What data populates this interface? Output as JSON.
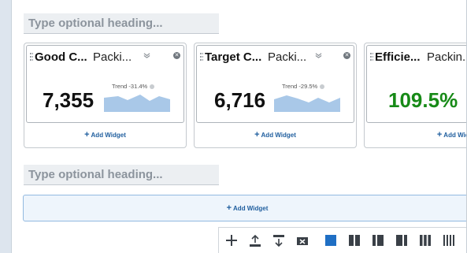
{
  "headings": {
    "top_placeholder": "Type optional heading...",
    "bottom_placeholder": "Type optional heading..."
  },
  "widgets": [
    {
      "title": "Good C...",
      "subtitle": "Packi...",
      "value": "7,355",
      "trend": "Trend -31.4%",
      "value_color": "#111111",
      "add_label": "Add Widget"
    },
    {
      "title": "Target C...",
      "subtitle": "Packi...",
      "value": "6,716",
      "trend": "Trend -29.5%",
      "value_color": "#111111",
      "add_label": "Add Widget"
    },
    {
      "title": "Efficie...",
      "subtitle": "Packin...",
      "value": "109.5%",
      "trend": "",
      "value_color": "#178a17",
      "add_label": "Add Widge"
    }
  ],
  "dropzone": {
    "add_label": "Add Widget"
  },
  "toolbar": {
    "buttons": [
      "add-icon",
      "upload-row-icon",
      "insert-row-icon",
      "delete-row-icon",
      "layout-1-col-icon",
      "layout-2-col-icon",
      "layout-2-col-wide-right-icon",
      "layout-2-col-wide-left-icon",
      "layout-3-col-icon",
      "layout-4-col-icon"
    ],
    "active": "layout-1-col-icon"
  },
  "colors": {
    "accent": "#1f6fc4",
    "link": "#1f5e9e",
    "spark_fill": "#a9c8e8",
    "positive": "#178a17"
  }
}
